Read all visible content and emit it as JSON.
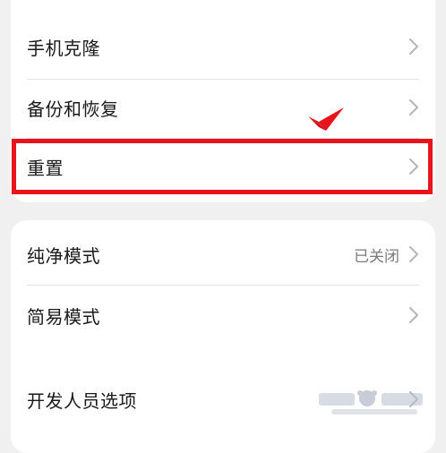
{
  "sections": [
    {
      "items": [
        {
          "label": "手机克隆",
          "icon": "chevron-right-icon"
        },
        {
          "label": "备份和恢复",
          "icon": "chevron-right-icon"
        },
        {
          "label": "重置",
          "icon": "chevron-right-icon",
          "highlighted": true
        }
      ]
    },
    {
      "items": [
        {
          "label": "纯净模式",
          "value": "已关闭",
          "icon": "chevron-right-icon"
        },
        {
          "label": "简易模式",
          "icon": "chevron-right-icon"
        },
        {
          "label": "开发人员选项",
          "icon": "chevron-right-icon"
        }
      ]
    }
  ],
  "annotation": {
    "highlight_color": "#e8141b",
    "checkmark_color": "#e8141b"
  },
  "colors": {
    "background": "#f0f0f0",
    "card": "#ffffff",
    "text": "#1a1a1a",
    "secondary_text": "#7a7a7a",
    "chevron": "#b5b5b5"
  }
}
